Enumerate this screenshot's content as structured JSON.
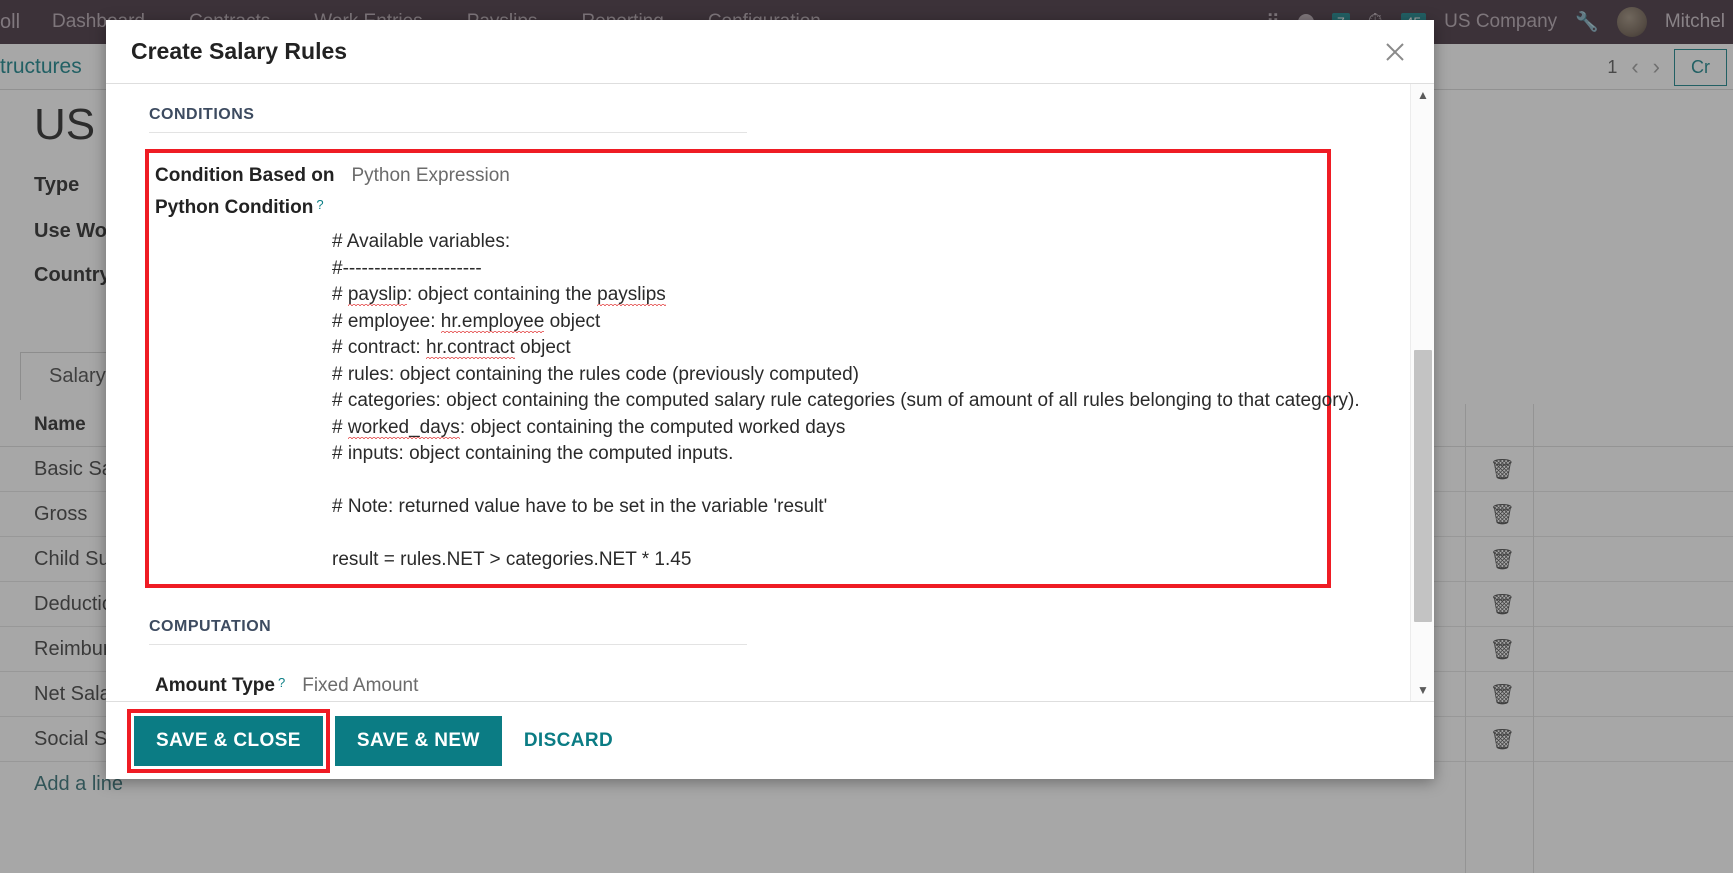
{
  "background": {
    "topbar": {
      "brand": "oll",
      "menu": [
        "Dashboard",
        "Contracts",
        "Work Entries",
        "Payslips",
        "Reporting",
        "Configuration"
      ],
      "grid_icon": "grid-dots-icon",
      "chat_icon": "chat-icon",
      "chat_count": "7",
      "clock_icon": "clock-icon",
      "activity_count": "45",
      "company": "US Company",
      "debug_icon": "wrench-icon",
      "user": "Mitchel"
    },
    "breadcrumb": "Structures",
    "pager": {
      "count": "1",
      "prev": "‹",
      "next": "›",
      "create_label": "Cr"
    },
    "record_title": "US F",
    "fields": [
      {
        "label": "Type"
      },
      {
        "label": "Use Work"
      },
      {
        "label": "Country"
      }
    ],
    "tab": "Salary R",
    "table": {
      "header": "Name",
      "rows": [
        {
          "name": "Basic Sala",
          "delete_icon": "trash-icon"
        },
        {
          "name": "Gross",
          "delete_icon": "trash-icon"
        },
        {
          "name": "Child Sup",
          "delete_icon": "trash-icon"
        },
        {
          "name": "Deduction",
          "delete_icon": "trash-icon"
        },
        {
          "name": "Reimburse",
          "delete_icon": "trash-icon"
        },
        {
          "name": "Net Salary",
          "delete_icon": "trash-icon"
        },
        {
          "name": "Social Sec",
          "delete_icon": "trash-icon"
        }
      ],
      "add_line": "Add a line"
    }
  },
  "modal": {
    "title": "Create Salary Rules",
    "close_icon": "close-icon",
    "sections": {
      "conditions_title": "CONDITIONS",
      "computation_title": "COMPUTATION"
    },
    "condition_based_on": {
      "label": "Condition Based on",
      "value": "Python Expression"
    },
    "python_condition": {
      "label": "Python Condition",
      "help_marker": "?",
      "code_lines": [
        "# Available variables:",
        "#----------------------",
        "# payslip: object containing the payslips",
        "# employee: hr.employee object",
        "# contract: hr.contract object",
        "# rules: object containing the rules code (previously computed)",
        "# categories: object containing the computed salary rule categories (sum of amount of all rules belonging to that category).",
        "# worked_days: object containing the computed worked days",
        "# inputs: object containing the computed inputs.",
        "",
        "# Note: returned value have to be set in the variable 'result'",
        "",
        "result = rules.NET > categories.NET * 1.45"
      ]
    },
    "amount_type": {
      "label": "Amount Type",
      "help_marker": "?",
      "value": "Fixed Amount"
    },
    "scrollbar": {
      "up_icon": "caret-up-icon",
      "down_icon": "caret-down-icon"
    },
    "footer": {
      "save_close": "SAVE & CLOSE",
      "save_new": "SAVE & NEW",
      "discard": "DISCARD"
    }
  },
  "colors": {
    "accent_teal": "#0b7c84",
    "highlight_red": "#ef1c24",
    "topbar": "#3c2a37"
  }
}
